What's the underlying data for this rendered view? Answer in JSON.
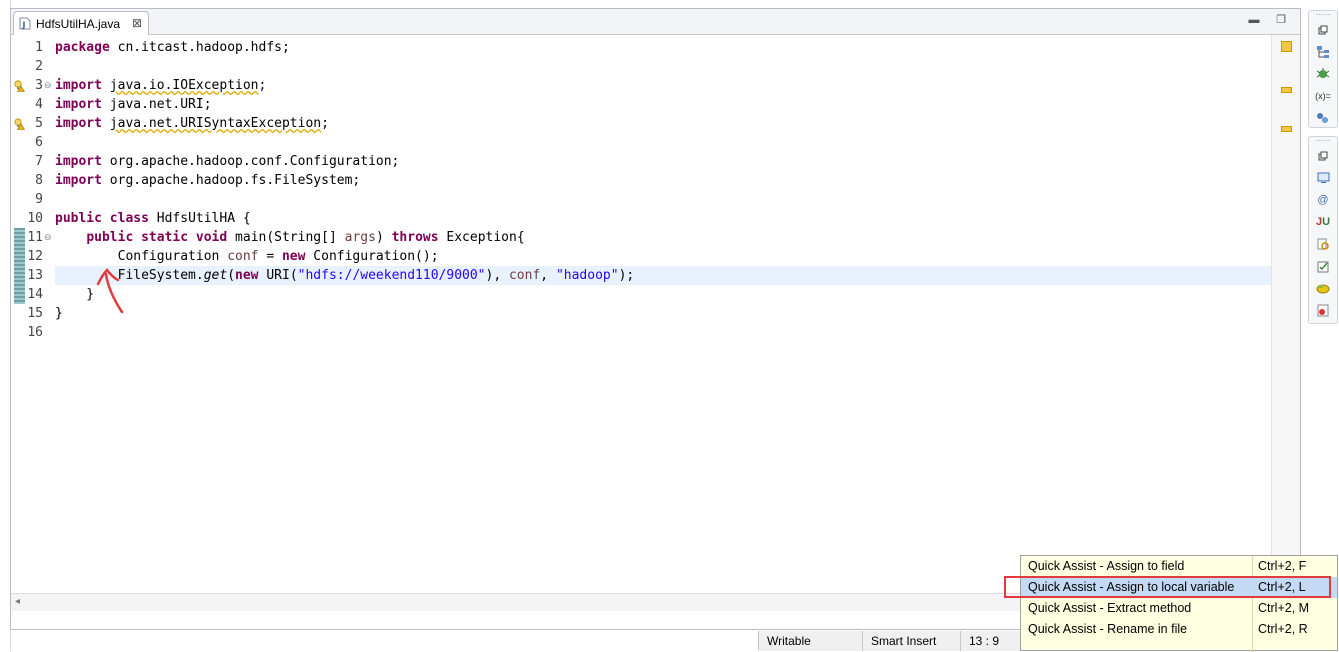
{
  "editor": {
    "tab_title": "HdfsUtilHA.java",
    "close_glyph": "⊠"
  },
  "code_lines": [
    {
      "n": "1",
      "segments": [
        {
          "t": "package",
          "c": "kw"
        },
        {
          "t": " cn.itcast.hadoop.hdfs;",
          "c": ""
        }
      ]
    },
    {
      "n": "2",
      "segments": []
    },
    {
      "n": "3",
      "segments": [
        {
          "t": "import",
          "c": "kw"
        },
        {
          "t": " ",
          "c": ""
        },
        {
          "t": "java.io.IOException",
          "c": "warn-ul"
        },
        {
          "t": ";",
          "c": ""
        }
      ]
    },
    {
      "n": "4",
      "segments": [
        {
          "t": "import",
          "c": "kw"
        },
        {
          "t": " java.net.URI;",
          "c": ""
        }
      ]
    },
    {
      "n": "5",
      "segments": [
        {
          "t": "import",
          "c": "kw"
        },
        {
          "t": " ",
          "c": ""
        },
        {
          "t": "java.net.URISyntaxException",
          "c": "warn-ul"
        },
        {
          "t": ";",
          "c": ""
        }
      ]
    },
    {
      "n": "6",
      "segments": []
    },
    {
      "n": "7",
      "segments": [
        {
          "t": "import",
          "c": "kw"
        },
        {
          "t": " org.apache.hadoop.conf.Configuration;",
          "c": ""
        }
      ]
    },
    {
      "n": "8",
      "segments": [
        {
          "t": "import",
          "c": "kw"
        },
        {
          "t": " org.apache.hadoop.fs.FileSystem;",
          "c": ""
        }
      ]
    },
    {
      "n": "9",
      "segments": []
    },
    {
      "n": "10",
      "segments": [
        {
          "t": "public",
          "c": "kw"
        },
        {
          "t": " ",
          "c": ""
        },
        {
          "t": "class",
          "c": "kw"
        },
        {
          "t": " HdfsUtilHA {",
          "c": ""
        }
      ]
    },
    {
      "n": "11",
      "segments": [
        {
          "t": "    ",
          "c": ""
        },
        {
          "t": "public",
          "c": "kw"
        },
        {
          "t": " ",
          "c": ""
        },
        {
          "t": "static",
          "c": "kw"
        },
        {
          "t": " ",
          "c": ""
        },
        {
          "t": "void",
          "c": "kw"
        },
        {
          "t": " main(String[] ",
          "c": ""
        },
        {
          "t": "args",
          "c": "var"
        },
        {
          "t": ") ",
          "c": ""
        },
        {
          "t": "throws",
          "c": "kw"
        },
        {
          "t": " Exception{",
          "c": ""
        }
      ]
    },
    {
      "n": "12",
      "segments": [
        {
          "t": "        Configuration ",
          "c": ""
        },
        {
          "t": "conf",
          "c": "var"
        },
        {
          "t": " = ",
          "c": ""
        },
        {
          "t": "new",
          "c": "kw"
        },
        {
          "t": " Configuration();",
          "c": ""
        }
      ]
    },
    {
      "n": "13",
      "segments": [
        {
          "t": "        FileSystem.",
          "c": ""
        },
        {
          "t": "get",
          "c": "it"
        },
        {
          "t": "(",
          "c": ""
        },
        {
          "t": "new",
          "c": "kw"
        },
        {
          "t": " URI(",
          "c": ""
        },
        {
          "t": "\"hdfs://weekend110/9000\"",
          "c": "str"
        },
        {
          "t": "), ",
          "c": ""
        },
        {
          "t": "conf",
          "c": "var"
        },
        {
          "t": ", ",
          "c": ""
        },
        {
          "t": "\"hadoop\"",
          "c": "str"
        },
        {
          "t": ");",
          "c": ""
        }
      ],
      "current": true
    },
    {
      "n": "14",
      "segments": [
        {
          "t": "    }",
          "c": ""
        }
      ]
    },
    {
      "n": "15",
      "segments": [
        {
          "t": "}",
          "c": ""
        }
      ]
    },
    {
      "n": "16",
      "segments": []
    }
  ],
  "status_bar": {
    "writable": "Writable",
    "insert_mode": "Smart Insert",
    "cursor_position": "13 : 9"
  },
  "quick_assist": [
    {
      "label": "Quick Assist - Assign to field",
      "shortcut": "Ctrl+2, F"
    },
    {
      "label": "Quick Assist - Assign to local variable",
      "shortcut": "Ctrl+2, L",
      "selected": true
    },
    {
      "label": "Quick Assist - Extract method",
      "shortcut": "Ctrl+2, M"
    },
    {
      "label": "Quick Assist - Rename in file",
      "shortcut": "Ctrl+2, R"
    }
  ],
  "right_toolbar_icons": [
    "restore-icon",
    "outline-icon",
    "debug-icon",
    "variables-icon",
    "breakpoints-icon",
    "restore-icon",
    "console-icon",
    "javadoc-icon",
    "junit-icon",
    "search-icon",
    "tasks-icon",
    "problems-icon",
    "error-log-icon"
  ],
  "colors": {
    "keyword": "#7f0055",
    "string": "#2a00ff",
    "variable": "#6a3e3e",
    "current_line": "#e8f2fe",
    "popup_bg": "#ffffe1",
    "selection": "#c4d9f3",
    "annotation_red": "#e33b3b"
  }
}
